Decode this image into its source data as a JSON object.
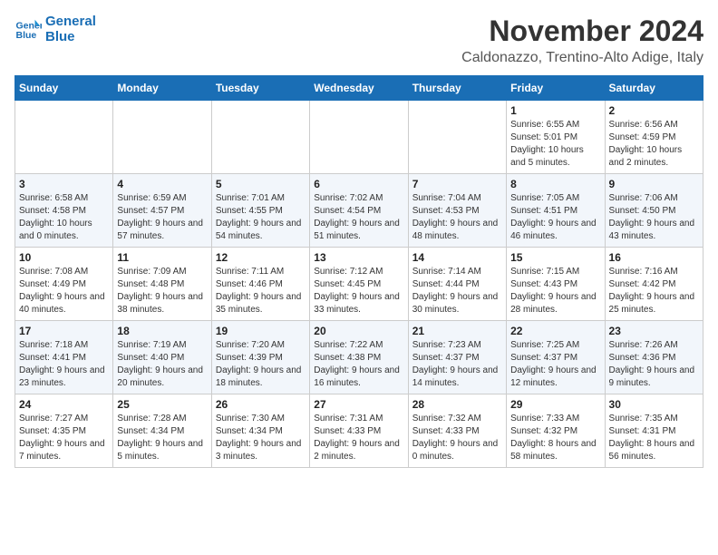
{
  "logo": {
    "line1": "General",
    "line2": "Blue"
  },
  "title": "November 2024",
  "location": "Caldonazzo, Trentino-Alto Adige, Italy",
  "weekdays": [
    "Sunday",
    "Monday",
    "Tuesday",
    "Wednesday",
    "Thursday",
    "Friday",
    "Saturday"
  ],
  "weeks": [
    [
      {
        "day": "",
        "info": ""
      },
      {
        "day": "",
        "info": ""
      },
      {
        "day": "",
        "info": ""
      },
      {
        "day": "",
        "info": ""
      },
      {
        "day": "",
        "info": ""
      },
      {
        "day": "1",
        "info": "Sunrise: 6:55 AM\nSunset: 5:01 PM\nDaylight: 10 hours and 5 minutes."
      },
      {
        "day": "2",
        "info": "Sunrise: 6:56 AM\nSunset: 4:59 PM\nDaylight: 10 hours and 2 minutes."
      }
    ],
    [
      {
        "day": "3",
        "info": "Sunrise: 6:58 AM\nSunset: 4:58 PM\nDaylight: 10 hours and 0 minutes."
      },
      {
        "day": "4",
        "info": "Sunrise: 6:59 AM\nSunset: 4:57 PM\nDaylight: 9 hours and 57 minutes."
      },
      {
        "day": "5",
        "info": "Sunrise: 7:01 AM\nSunset: 4:55 PM\nDaylight: 9 hours and 54 minutes."
      },
      {
        "day": "6",
        "info": "Sunrise: 7:02 AM\nSunset: 4:54 PM\nDaylight: 9 hours and 51 minutes."
      },
      {
        "day": "7",
        "info": "Sunrise: 7:04 AM\nSunset: 4:53 PM\nDaylight: 9 hours and 48 minutes."
      },
      {
        "day": "8",
        "info": "Sunrise: 7:05 AM\nSunset: 4:51 PM\nDaylight: 9 hours and 46 minutes."
      },
      {
        "day": "9",
        "info": "Sunrise: 7:06 AM\nSunset: 4:50 PM\nDaylight: 9 hours and 43 minutes."
      }
    ],
    [
      {
        "day": "10",
        "info": "Sunrise: 7:08 AM\nSunset: 4:49 PM\nDaylight: 9 hours and 40 minutes."
      },
      {
        "day": "11",
        "info": "Sunrise: 7:09 AM\nSunset: 4:48 PM\nDaylight: 9 hours and 38 minutes."
      },
      {
        "day": "12",
        "info": "Sunrise: 7:11 AM\nSunset: 4:46 PM\nDaylight: 9 hours and 35 minutes."
      },
      {
        "day": "13",
        "info": "Sunrise: 7:12 AM\nSunset: 4:45 PM\nDaylight: 9 hours and 33 minutes."
      },
      {
        "day": "14",
        "info": "Sunrise: 7:14 AM\nSunset: 4:44 PM\nDaylight: 9 hours and 30 minutes."
      },
      {
        "day": "15",
        "info": "Sunrise: 7:15 AM\nSunset: 4:43 PM\nDaylight: 9 hours and 28 minutes."
      },
      {
        "day": "16",
        "info": "Sunrise: 7:16 AM\nSunset: 4:42 PM\nDaylight: 9 hours and 25 minutes."
      }
    ],
    [
      {
        "day": "17",
        "info": "Sunrise: 7:18 AM\nSunset: 4:41 PM\nDaylight: 9 hours and 23 minutes."
      },
      {
        "day": "18",
        "info": "Sunrise: 7:19 AM\nSunset: 4:40 PM\nDaylight: 9 hours and 20 minutes."
      },
      {
        "day": "19",
        "info": "Sunrise: 7:20 AM\nSunset: 4:39 PM\nDaylight: 9 hours and 18 minutes."
      },
      {
        "day": "20",
        "info": "Sunrise: 7:22 AM\nSunset: 4:38 PM\nDaylight: 9 hours and 16 minutes."
      },
      {
        "day": "21",
        "info": "Sunrise: 7:23 AM\nSunset: 4:37 PM\nDaylight: 9 hours and 14 minutes."
      },
      {
        "day": "22",
        "info": "Sunrise: 7:25 AM\nSunset: 4:37 PM\nDaylight: 9 hours and 12 minutes."
      },
      {
        "day": "23",
        "info": "Sunrise: 7:26 AM\nSunset: 4:36 PM\nDaylight: 9 hours and 9 minutes."
      }
    ],
    [
      {
        "day": "24",
        "info": "Sunrise: 7:27 AM\nSunset: 4:35 PM\nDaylight: 9 hours and 7 minutes."
      },
      {
        "day": "25",
        "info": "Sunrise: 7:28 AM\nSunset: 4:34 PM\nDaylight: 9 hours and 5 minutes."
      },
      {
        "day": "26",
        "info": "Sunrise: 7:30 AM\nSunset: 4:34 PM\nDaylight: 9 hours and 3 minutes."
      },
      {
        "day": "27",
        "info": "Sunrise: 7:31 AM\nSunset: 4:33 PM\nDaylight: 9 hours and 2 minutes."
      },
      {
        "day": "28",
        "info": "Sunrise: 7:32 AM\nSunset: 4:33 PM\nDaylight: 9 hours and 0 minutes."
      },
      {
        "day": "29",
        "info": "Sunrise: 7:33 AM\nSunset: 4:32 PM\nDaylight: 8 hours and 58 minutes."
      },
      {
        "day": "30",
        "info": "Sunrise: 7:35 AM\nSunset: 4:31 PM\nDaylight: 8 hours and 56 minutes."
      }
    ]
  ]
}
